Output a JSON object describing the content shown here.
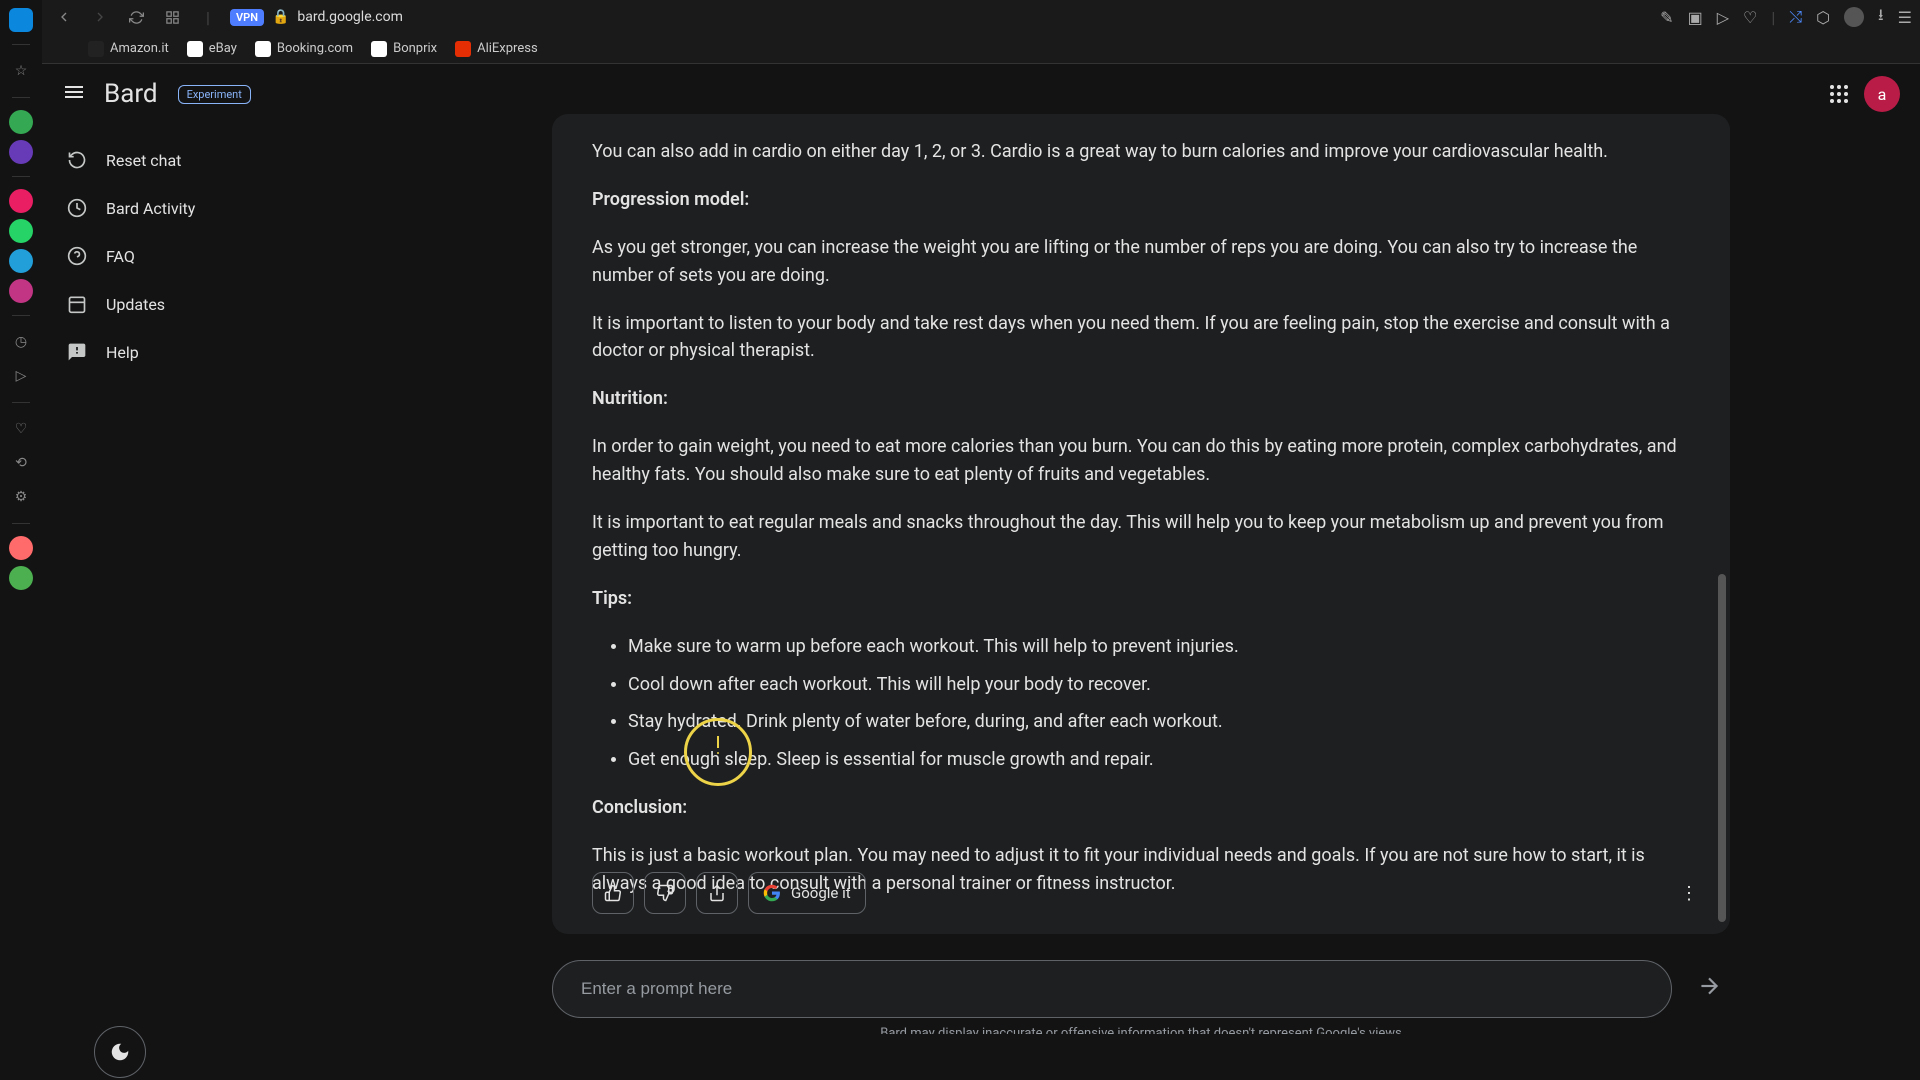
{
  "browser": {
    "url": "bard.google.com",
    "vpn": "VPN",
    "bookmarks": [
      {
        "label": "Amazon.it"
      },
      {
        "label": "eBay"
      },
      {
        "label": "Booking.com"
      },
      {
        "label": "Bonprix"
      },
      {
        "label": "AliExpress"
      }
    ]
  },
  "app": {
    "title": "Bard",
    "badge": "Experiment",
    "avatar_initial": "a"
  },
  "nav": {
    "reset": "Reset chat",
    "activity": "Bard Activity",
    "faq": "FAQ",
    "updates": "Updates",
    "help": "Help"
  },
  "message": {
    "p1": "You can also add in cardio on either day 1, 2, or 3. Cardio is a great way to burn calories and improve your cardiovascular health.",
    "h_progression": "Progression model:",
    "p2": "As you get stronger, you can increase the weight you are lifting or the number of reps you are doing. You can also try to increase the number of sets you are doing.",
    "p3": "It is important to listen to your body and take rest days when you need them. If you are feeling pain, stop the exercise and consult with a doctor or physical therapist.",
    "h_nutrition": "Nutrition:",
    "p4": "In order to gain weight, you need to eat more calories than you burn. You can do this by eating more protein, complex carbohydrates, and healthy fats. You should also make sure to eat plenty of fruits and vegetables.",
    "p5": "It is important to eat regular meals and snacks throughout the day. This will help you to keep your metabolism up and prevent you from getting too hungry.",
    "h_tips": "Tips:",
    "tips": [
      "Make sure to warm up before each workout. This will help to prevent injuries.",
      "Cool down after each workout. This will help your body to recover.",
      "Stay hydrated. Drink plenty of water before, during, and after each workout.",
      "Get enough sleep. Sleep is essential for muscle growth and repair."
    ],
    "h_conclusion": "Conclusion:",
    "p6": "This is just a basic workout plan. You may need to adjust it to fit your individual needs and goals. If you are not sure how to start, it is always a good idea to consult with a personal trainer or fitness instructor."
  },
  "actions": {
    "google_it": "Google it"
  },
  "input": {
    "placeholder": "Enter a prompt here"
  },
  "footer": "Bard may display inaccurate or offensive information that doesn't represent Google's views"
}
